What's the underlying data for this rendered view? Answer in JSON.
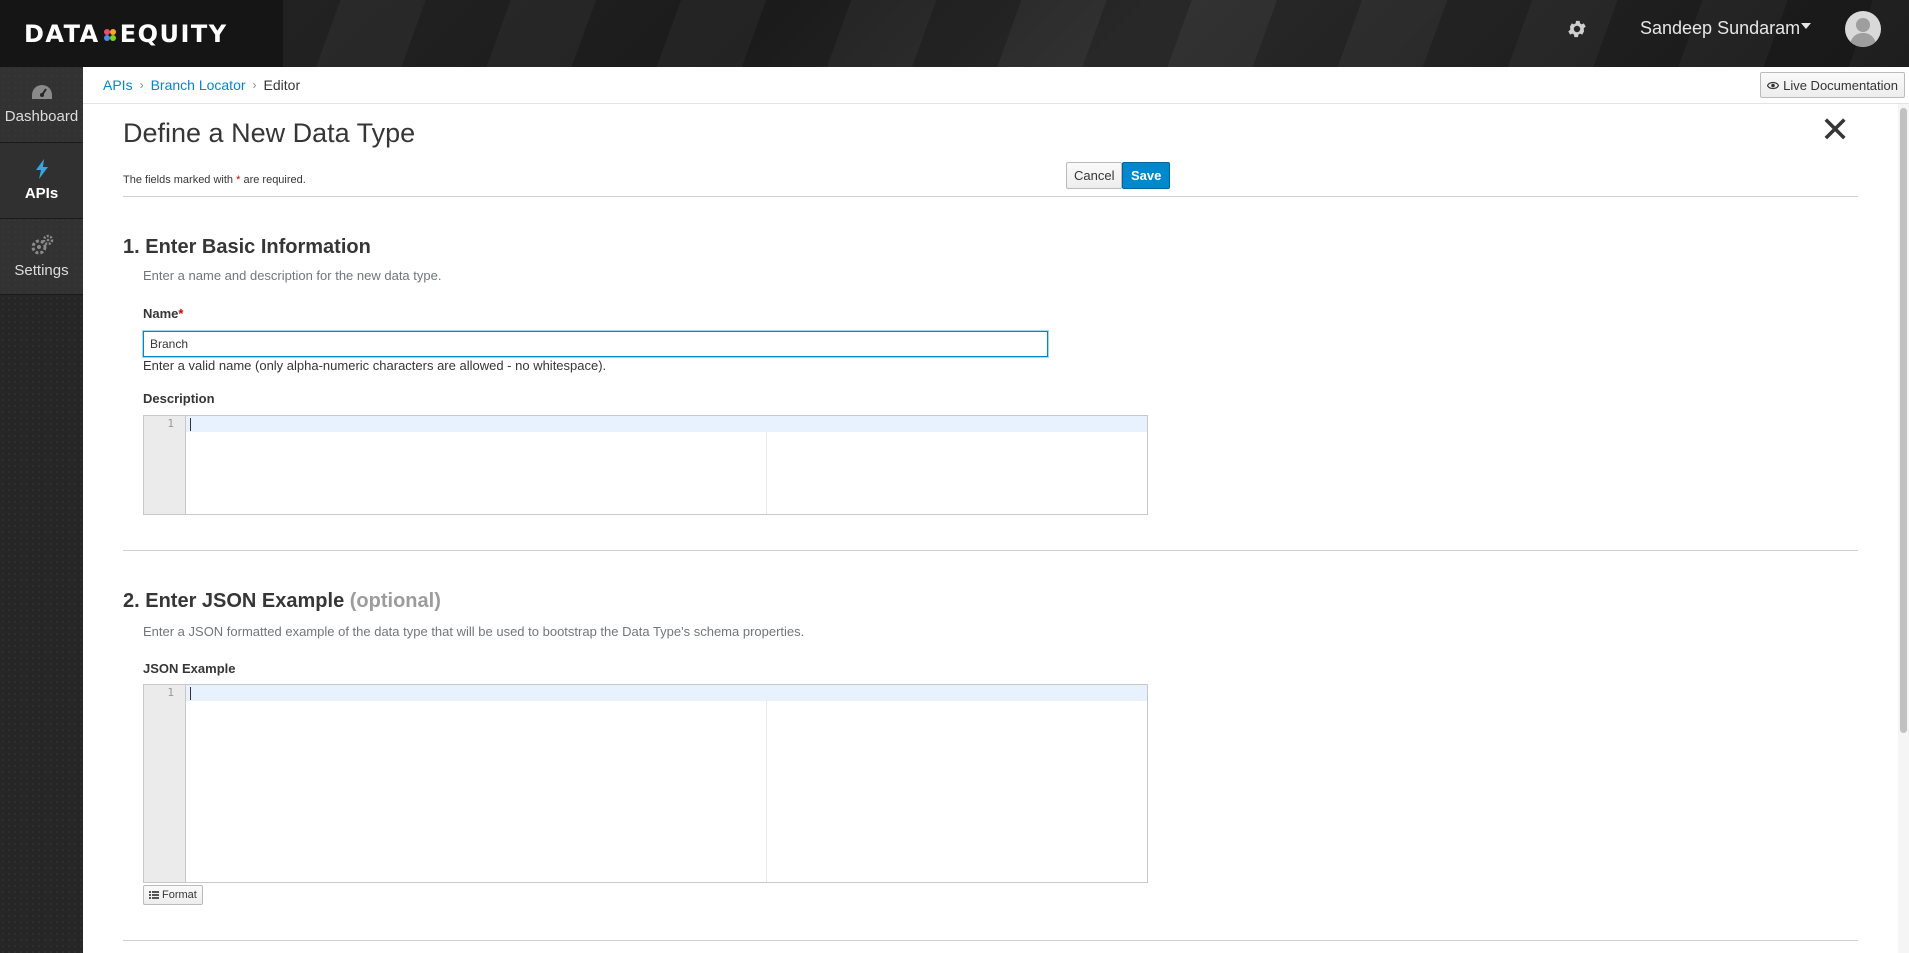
{
  "header": {
    "brand_left": "DATA",
    "brand_right": "EQUITY",
    "settings_icon": "gear-icon",
    "user_name": "Sandeep Sundaram",
    "user_menu_icon": "caret-down-icon",
    "avatar_icon": "user-avatar-icon"
  },
  "sidebar": {
    "items": [
      {
        "label": "Dashboard",
        "icon": "dashboard-icon",
        "active": false
      },
      {
        "label": "APIs",
        "icon": "bolt-icon",
        "active": true
      },
      {
        "label": "Settings",
        "icon": "gears-icon",
        "active": false
      }
    ]
  },
  "breadcrumb": {
    "items": [
      "APIs",
      "Branch Locator"
    ],
    "current": "Editor",
    "separator": "›"
  },
  "live_doc": {
    "label": "Live Documentation",
    "icon": "eye-icon"
  },
  "form": {
    "title": "Define a New Data Type",
    "close_glyph": "✕",
    "required_note_prefix": "The fields marked with",
    "required_star": "*",
    "required_note_suffix": "are required.",
    "cancel_label": "Cancel",
    "save_label": "Save",
    "section1": {
      "title": "1. Enter Basic Information",
      "desc": "Enter a name and description for the new data type.",
      "name_label": "Name",
      "name_star": "*",
      "name_value": "Branch",
      "name_help": "Enter a valid name (only alpha-numeric characters are allowed - no whitespace).",
      "description_label": "Description",
      "description_line": "1"
    },
    "section2": {
      "title": "2. Enter JSON Example",
      "title_optional": "(optional)",
      "desc": "Enter a JSON formatted example of the data type that will be used to bootstrap the Data Type's schema properties.",
      "json_label": "JSON Example",
      "json_line": "1",
      "format_label": "Format",
      "format_icon": "list-icon"
    }
  },
  "colors": {
    "accent": "#0088ce",
    "required": "#cc0000",
    "sidebar_bg": "#262626",
    "header_bg": "#1f1f1f"
  }
}
